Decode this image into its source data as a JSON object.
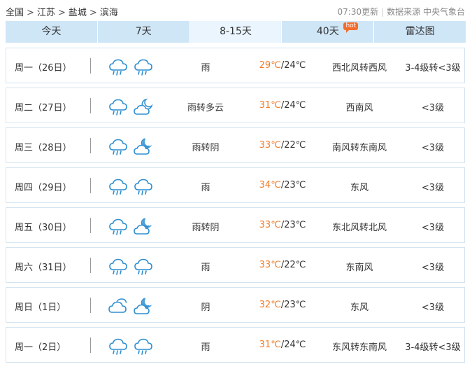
{
  "breadcrumb": {
    "items": [
      "全国",
      "江苏",
      "盐城",
      "滨海"
    ],
    "separator": ">"
  },
  "meta": {
    "updated": "07:30更新",
    "source": "数据来源 中央气象台"
  },
  "tabs": [
    {
      "label": "今天",
      "active": false
    },
    {
      "label": "7天",
      "active": false
    },
    {
      "label": "8-15天",
      "active": true
    },
    {
      "label": "40天",
      "active": false,
      "badge": "hot"
    },
    {
      "label": "雷达图",
      "active": false
    }
  ],
  "colors": {
    "tab_bg": "#cfe6f7",
    "tab_active_bg": "#eaf5fd",
    "high_temp": "#f07d2a",
    "icon_blue": "#2f8fd0",
    "hot_badge": "#f26d2b"
  },
  "forecast": [
    {
      "day": "周一（26日）",
      "icon1": "rain-icon",
      "icon2": "rain-icon",
      "desc": "雨",
      "high": "29℃",
      "low": "/24℃",
      "wind": "西北风转西风",
      "level": "3-4级转<3级"
    },
    {
      "day": "周二（27日）",
      "icon1": "rain-icon",
      "icon2": "partly-cloudy-night-icon",
      "desc": "雨转多云",
      "high": "31℃",
      "low": "/24℃",
      "wind": "西南风",
      "level": "<3级"
    },
    {
      "day": "周三（28日）",
      "icon1": "rain-icon",
      "icon2": "cloudy-night-icon",
      "desc": "雨转阴",
      "high": "33℃",
      "low": "/22℃",
      "wind": "南风转东南风",
      "level": "<3级"
    },
    {
      "day": "周四（29日）",
      "icon1": "rain-icon",
      "icon2": "rain-icon",
      "desc": "雨",
      "high": "34℃",
      "low": "/23℃",
      "wind": "东风",
      "level": "<3级"
    },
    {
      "day": "周五（30日）",
      "icon1": "rain-icon",
      "icon2": "cloudy-night-icon",
      "desc": "雨转阴",
      "high": "33℃",
      "low": "/23℃",
      "wind": "东北风转北风",
      "level": "<3级"
    },
    {
      "day": "周六（31日）",
      "icon1": "rain-icon",
      "icon2": "rain-icon",
      "desc": "雨",
      "high": "33℃",
      "low": "/22℃",
      "wind": "东南风",
      "level": "<3级"
    },
    {
      "day": "周日（1日）",
      "icon1": "overcast-icon",
      "icon2": "cloudy-night-icon",
      "desc": "阴",
      "high": "32℃",
      "low": "/23℃",
      "wind": "东风",
      "level": "<3级"
    },
    {
      "day": "周一（2日）",
      "icon1": "rain-icon",
      "icon2": "rain-icon",
      "desc": "雨",
      "high": "31℃",
      "low": "/24℃",
      "wind": "东风转东南风",
      "level": "3-4级转<3级"
    }
  ]
}
